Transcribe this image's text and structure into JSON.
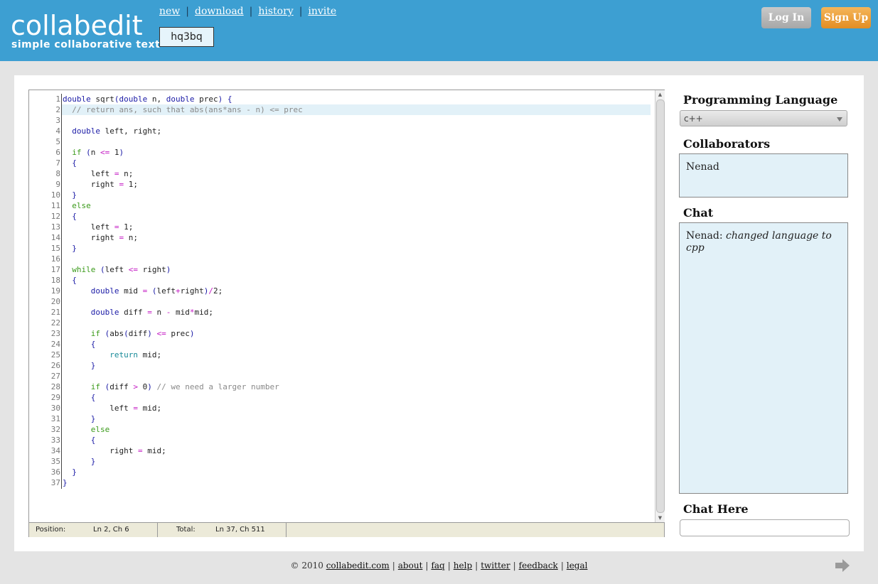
{
  "header": {
    "logo_title": "collabedit",
    "logo_subtitle": "simple collaborative text",
    "nav": [
      "new",
      "download",
      "history",
      "invite"
    ],
    "doc_id": "hq3bq",
    "login_label": "Log In",
    "signup_label": "Sign Up"
  },
  "editor": {
    "line_numbers": [
      "1",
      "2",
      "3",
      "4",
      "5",
      "6",
      "7",
      "8",
      "9",
      "10",
      "11",
      "12",
      "13",
      "14",
      "15",
      "16",
      "17",
      "18",
      "19",
      "20",
      "21",
      "22",
      "23",
      "24",
      "25",
      "26",
      "27",
      "28",
      "29",
      "30",
      "31",
      "32",
      "33",
      "34",
      "35",
      "36",
      "37"
    ],
    "code_lines": [
      "double sqrt(double n, double prec) {",
      "  // return ans, such that abs(ans*ans - n) <= prec",
      "",
      "  double left, right;",
      "",
      "  if (n <= 1)",
      "  {",
      "      left = n;",
      "      right = 1;",
      "  }",
      "  else",
      "  {",
      "      left = 1;",
      "      right = n;",
      "  }",
      "",
      "  while (left <= right)",
      "  {",
      "      double mid = (left+right)/2;",
      "",
      "      double diff = n - mid*mid;",
      "",
      "      if (abs(diff) <= prec)",
      "      {",
      "          return mid;",
      "      }",
      "",
      "      if (diff > 0) // we need a larger number",
      "      {",
      "          left = mid;",
      "      }",
      "      else",
      "      {",
      "          right = mid;",
      "      }",
      "  }",
      "}"
    ],
    "highlighted_line": 2,
    "status": {
      "position_label": "Position:",
      "position_value": "Ln 2, Ch 6",
      "total_label": "Total:",
      "total_value": "Ln 37, Ch 511"
    }
  },
  "sidebar": {
    "language_heading": "Programming Language",
    "language_selected": "c++",
    "collaborators_heading": "Collaborators",
    "collaborators": [
      "Nenad"
    ],
    "chat_heading": "Chat",
    "chat_messages": [
      {
        "author": "Nenad:",
        "text": "changed language to cpp"
      }
    ],
    "chat_here_heading": "Chat Here"
  },
  "footer": {
    "copyright": "© 2010",
    "links": [
      "collabedit.com",
      "about",
      "faq",
      "help",
      "twitter",
      "feedback",
      "legal"
    ]
  },
  "colors": {
    "header_bg": "#3d9fd2",
    "signup": "#e38d23",
    "panel_box": "#e2f1f8"
  }
}
